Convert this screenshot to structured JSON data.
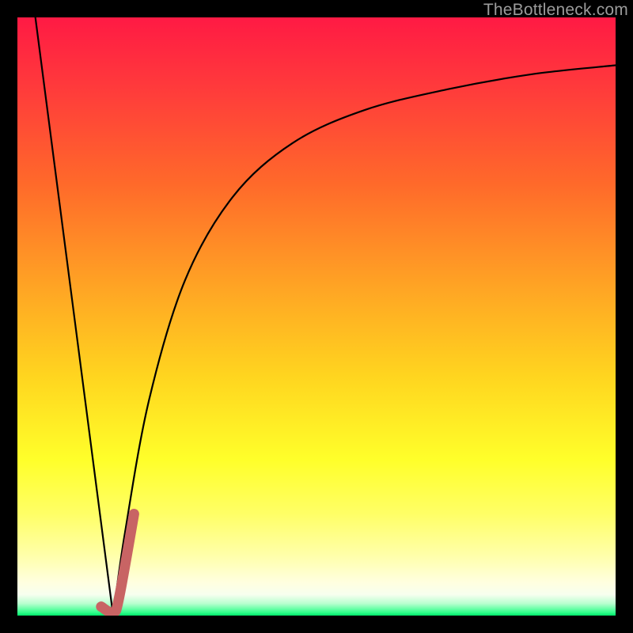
{
  "watermark": {
    "text": "TheBottleneck.com"
  },
  "colors": {
    "background": "#000000",
    "highlight_stroke": "#c86464",
    "curve_stroke": "#000000",
    "gradient_stops": [
      {
        "offset": 0.0,
        "color": "#ff1a44"
      },
      {
        "offset": 0.12,
        "color": "#ff3b3b"
      },
      {
        "offset": 0.28,
        "color": "#ff6a2a"
      },
      {
        "offset": 0.45,
        "color": "#ffa424"
      },
      {
        "offset": 0.6,
        "color": "#ffd51f"
      },
      {
        "offset": 0.74,
        "color": "#ffff2a"
      },
      {
        "offset": 0.83,
        "color": "#ffff66"
      },
      {
        "offset": 0.9,
        "color": "#ffffaa"
      },
      {
        "offset": 0.945,
        "color": "#ffffe0"
      },
      {
        "offset": 0.965,
        "color": "#f7ffef"
      },
      {
        "offset": 0.98,
        "color": "#b8ffcf"
      },
      {
        "offset": 0.995,
        "color": "#2fff8a"
      },
      {
        "offset": 1.0,
        "color": "#00e56a"
      }
    ]
  },
  "chart_data": {
    "type": "line",
    "title": "",
    "xlabel": "",
    "ylabel": "",
    "xlim": [
      0,
      100
    ],
    "ylim": [
      0,
      100
    ],
    "notes": "Bottleneck-style curve: y≈0 (green) is optimal. The V-shaped dip reaches the baseline near x≈16; a second asymptotic curve rises from there toward y≈92 as x→100. Short pink segment highlights the near-zero region around the dip.",
    "series": [
      {
        "name": "left-falling-line",
        "x": [
          3,
          16
        ],
        "y": [
          100,
          0
        ]
      },
      {
        "name": "right-rising-curve",
        "x": [
          16,
          18,
          22,
          28,
          36,
          46,
          58,
          72,
          86,
          100
        ],
        "y": [
          0,
          14,
          36,
          56,
          70,
          79,
          84.5,
          88,
          90.5,
          92
        ]
      },
      {
        "name": "highlight-hook",
        "x": [
          14,
          16,
          17,
          19.5
        ],
        "y": [
          1.5,
          0.5,
          3,
          17
        ]
      }
    ]
  }
}
